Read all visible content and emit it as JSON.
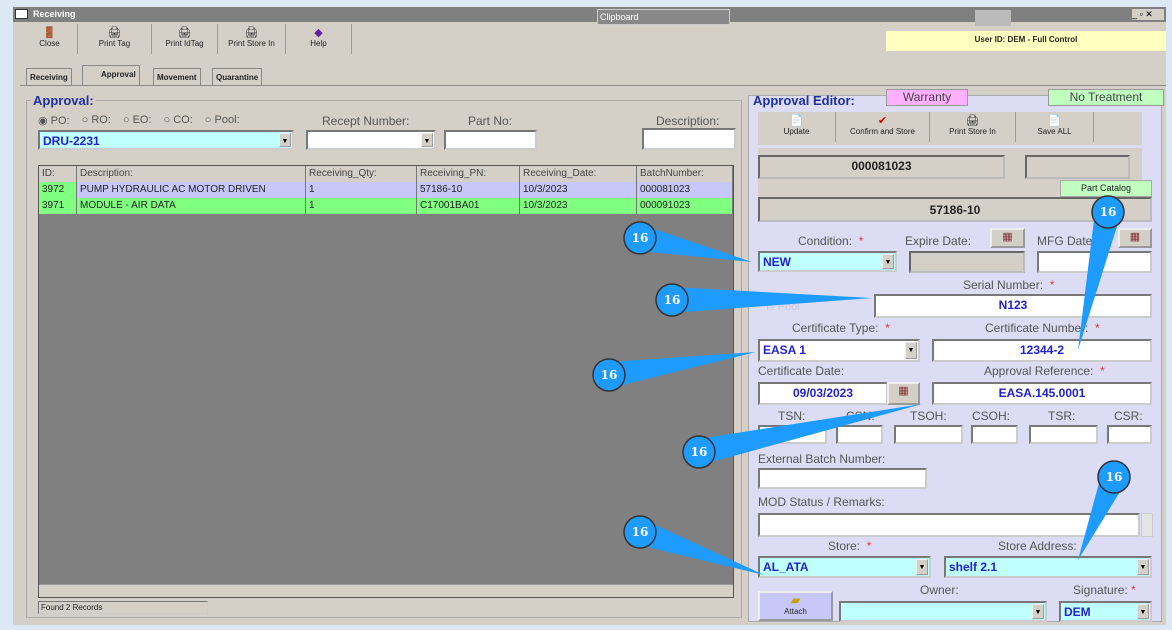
{
  "window": {
    "title": "Receiving",
    "clipboard": "Clipboard",
    "user": "User ID: DEM - Full Control"
  },
  "toolbar": [
    {
      "label": "Close",
      "icon": "door-exit-icon"
    },
    {
      "label": "Print Tag",
      "icon": "printer-icon"
    },
    {
      "label": "Print IdTag",
      "icon": "printer-icon"
    },
    {
      "label": "Print Store In",
      "icon": "printer-icon"
    },
    {
      "label": "Help",
      "icon": "help-book-icon"
    }
  ],
  "tabs": [
    "Receiving",
    "Approval",
    "Movement",
    "Quarantine"
  ],
  "approval": {
    "title": "Approval:",
    "radios": [
      "PO:",
      "RO:",
      "EO:",
      "CO:",
      "Pool:"
    ],
    "order_value": "DRU-2231",
    "recept_label": "Recept Number:",
    "partno_label": "Part No:",
    "description_label": "Description:"
  },
  "grid": {
    "headers": [
      "ID:",
      "Description:",
      "Receiving_Qty:",
      "Receiving_PN:",
      "Receiving_Date:",
      "BatchNumber:"
    ],
    "rows": [
      [
        "3972",
        "PUMP HYDRAULIC AC MOTOR DRIVEN",
        "1",
        "57186-10",
        "10/3/2023",
        "000081023"
      ],
      [
        "3971",
        "MODULE - AIR DATA",
        "1",
        "C17001BA01",
        "10/3/2023",
        "000091023"
      ]
    ],
    "status": "Found 2 Records"
  },
  "editor": {
    "title": "Approval Editor:",
    "warranty": "Warranty",
    "treatment": "No Treatment",
    "buttons": [
      "Update",
      "Confirm and Store",
      "Print Store In",
      "Save ALL"
    ],
    "batch": "000081023",
    "part_catalog": "Part Catalog",
    "pn": "57186-10",
    "condition_label": "Condition:",
    "condition": "NEW",
    "expire_label": "Expire Date:",
    "mfg_label": "MFG Date:",
    "serial_label": "Serial Number:",
    "serial": "N123",
    "is_pool": "Is Pool",
    "cert_type_label": "Certificate Type:",
    "cert_type": "EASA 1",
    "cert_number_label": "Certificate Number:",
    "cert_number": "12344-2",
    "cert_date_label": "Certificate Date:",
    "cert_date": "09/03/2023",
    "approval_ref_label": "Approval Reference:",
    "approval_ref": "EASA.145.0001",
    "times": [
      "TSN:",
      "CSN:",
      "TSOH:",
      "CSOH:",
      "TSR:",
      "CSR:"
    ],
    "ext_batch_label": "External Batch Number:",
    "mod_label": "MOD Status / Remarks:",
    "store_label": "Store:",
    "store": "AL_ATA",
    "store_addr_label": "Store Address:",
    "store_addr": "shelf 2.1",
    "attach": "Attach",
    "owner_label": "Owner:",
    "signature_label": "Signature:",
    "signature": "DEM",
    "required": "*"
  },
  "callouts": [
    "16",
    "16",
    "16",
    "16",
    "16",
    "16",
    "16"
  ],
  "colors": {
    "callout": "#1e9bff",
    "row_selected": "#c8c8f8",
    "row_green": "#80ff80",
    "cyan": "#c0ffff"
  }
}
